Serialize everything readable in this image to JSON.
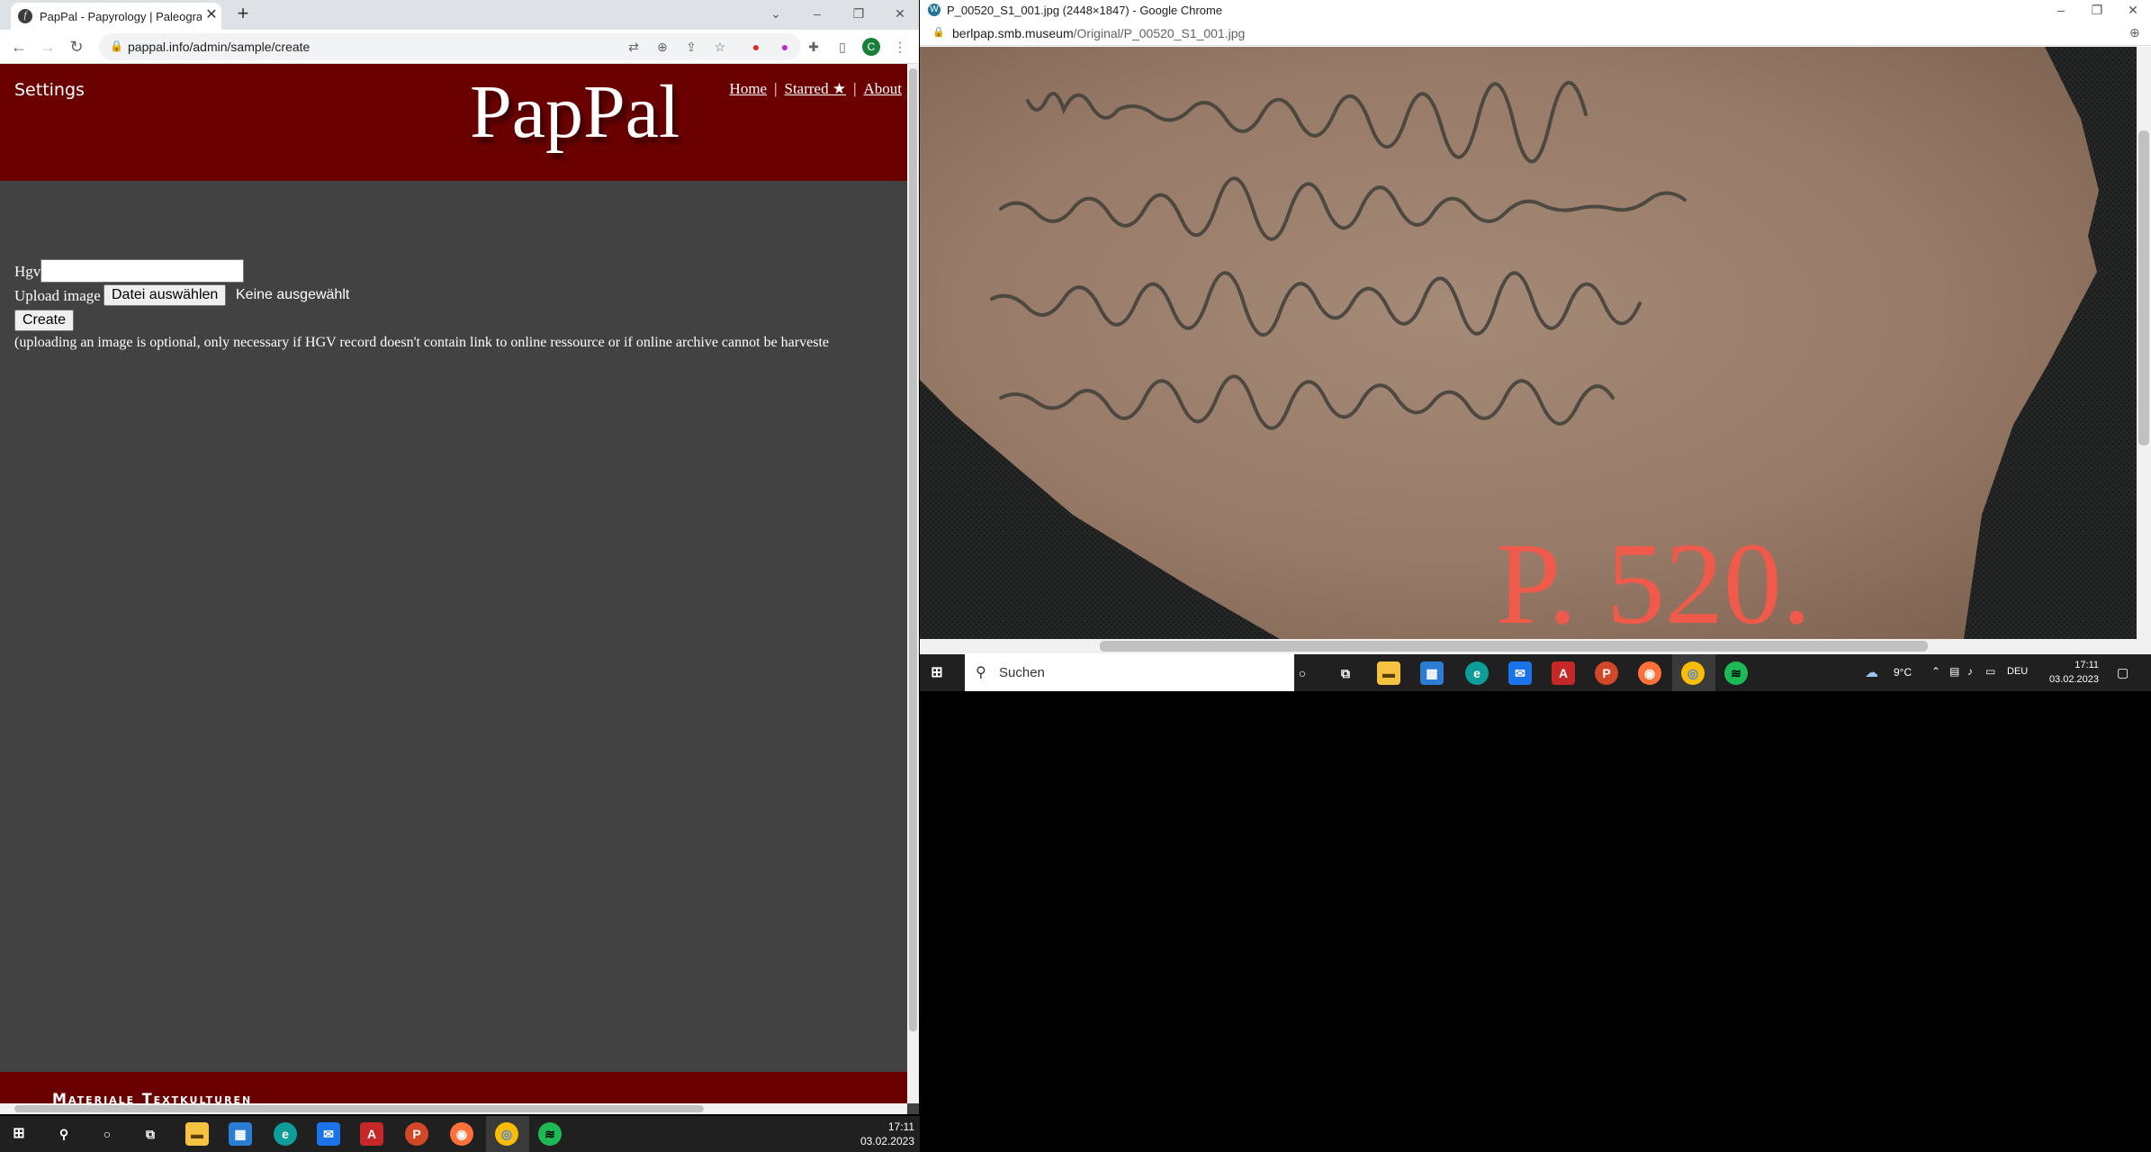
{
  "left_browser": {
    "tab_title": "PapPal - Papyrology | Paleography",
    "url": "pappal.info/admin/sample/create",
    "header": {
      "settings_label": "Settings",
      "logo": "PapPal",
      "nav": [
        "Home",
        "Starred ★",
        "About"
      ]
    },
    "form": {
      "hgv_label": "Hgv",
      "hgv_value": "",
      "upload_label": "Upload image",
      "file_button": "Datei auswählen",
      "file_status": "Keine ausgewählt",
      "create_button": "Create",
      "note": "(uploading an image is optional, only necessary if HGV record doesn't contain link to online ressource or if online archive cannot be harveste"
    },
    "footer_text": "Materiale Textkulturen"
  },
  "right_browser": {
    "window_title": "P_00520_S1_001.jpg (2448×1847) - Google Chrome",
    "url_host": "berlpap.smb.museum",
    "url_path": "/Original/P_00520_S1_001.jpg",
    "image_label": "P. 520."
  },
  "taskbar_main": {
    "time": "17:11",
    "date": "03.02.2023"
  },
  "taskbar_secondary": {
    "search_placeholder": "Suchen",
    "weather": "9°C",
    "language": "DEU",
    "time": "17:11",
    "date": "03.02.2023"
  },
  "colors": {
    "header_red": "#6b0000",
    "page_gray": "#424242",
    "taskbar": "#202020"
  }
}
